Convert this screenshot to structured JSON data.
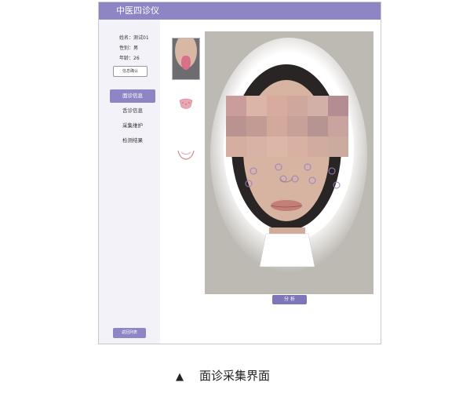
{
  "app": {
    "title": "中医四诊仪"
  },
  "patient": {
    "name_line": "姓名：测试01",
    "gender_line": "性别：男",
    "age_line": "年龄：26"
  },
  "sidebar": {
    "info_button_label": "信息确认",
    "nav_items": [
      {
        "label": "面诊信息",
        "active": true
      },
      {
        "label": "舌诊信息",
        "active": false
      },
      {
        "label": "采集维护",
        "active": false
      },
      {
        "label": "检测结果",
        "active": false
      }
    ],
    "bottom_button_label": "返回列表"
  },
  "main": {
    "analyze_button_label": "分 析"
  },
  "caption": {
    "arrow": "▲",
    "text": "面诊采集界面"
  },
  "colors": {
    "accent": "#8e86c4",
    "marker": "#9c7dc8"
  },
  "icons": {
    "caption_arrow": "triangle-up-icon"
  }
}
